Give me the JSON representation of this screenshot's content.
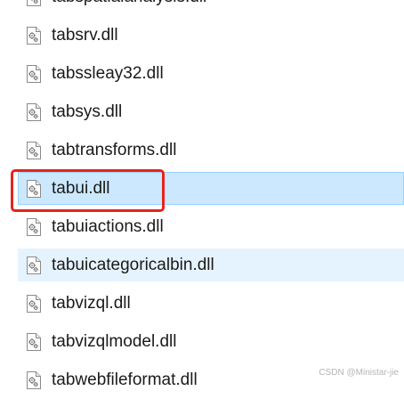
{
  "files": [
    {
      "name": "tabspatialanalysis.dll",
      "icon": "dll-file-icon",
      "state": "normal"
    },
    {
      "name": "tabsrv.dll",
      "icon": "dll-file-icon",
      "state": "normal"
    },
    {
      "name": "tabssleay32.dll",
      "icon": "dll-file-icon",
      "state": "normal"
    },
    {
      "name": "tabsys.dll",
      "icon": "dll-file-icon",
      "state": "normal"
    },
    {
      "name": "tabtransforms.dll",
      "icon": "dll-file-icon",
      "state": "normal"
    },
    {
      "name": "tabui.dll",
      "icon": "dll-file-icon",
      "state": "selected"
    },
    {
      "name": "tabuiactions.dll",
      "icon": "dll-file-icon",
      "state": "normal"
    },
    {
      "name": "tabuicategoricalbin.dll",
      "icon": "dll-file-icon",
      "state": "hover"
    },
    {
      "name": "tabvizql.dll",
      "icon": "dll-file-icon",
      "state": "normal"
    },
    {
      "name": "tabvizqlmodel.dll",
      "icon": "dll-file-icon",
      "state": "normal"
    },
    {
      "name": "tabwebfileformat.dll",
      "icon": "dll-file-icon",
      "state": "normal"
    }
  ],
  "annotation": {
    "color": "#e8231a",
    "target": "tabui.dll"
  },
  "colors": {
    "selected_bg": "#cce8ff",
    "selected_border": "#99d1ff",
    "hover_bg": "#e5f3ff"
  },
  "watermark": "CSDN @Ministar-jie"
}
